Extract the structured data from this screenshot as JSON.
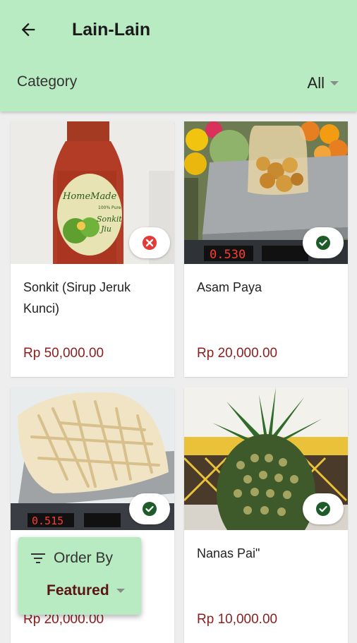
{
  "header": {
    "title": "Lain-Lain",
    "back_icon": "arrow-back-icon"
  },
  "category": {
    "label": "Category",
    "value": "All"
  },
  "products": [
    {
      "name": "Sonkit (Sirup Jeruk Kunci)",
      "price": "Rp 50,000.00",
      "status": "unavailable",
      "bottle_brand": "HomeMade",
      "bottle_sub": "100% Pure",
      "bottle_name1": "Sonkit",
      "bottle_name2": "Jiu"
    },
    {
      "name": "Asam Paya",
      "price": "Rp 20,000.00",
      "status": "available",
      "scale_reading": "0.530"
    },
    {
      "name": "",
      "price": "Rp 20,000.00",
      "status": "available",
      "scale_reading": "0.515"
    },
    {
      "name": "Nanas Pai\"",
      "price": "Rp 10,000.00",
      "status": "available"
    }
  ],
  "order_by": {
    "label": "Order By",
    "value": "Featured"
  },
  "colors": {
    "appbar": "#b8ebc1",
    "price": "#8b1e1e",
    "check": "#1e5b2b",
    "cross": "#e53935"
  }
}
